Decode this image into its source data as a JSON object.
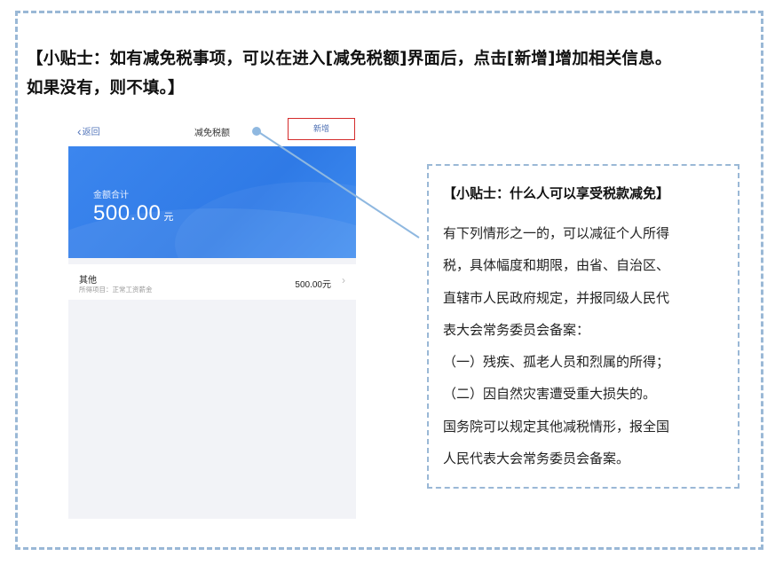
{
  "heading": {
    "line1": "【小贴士：如有减免税事项，可以在进入[减免税额]界面后，点击[新增]增加相关信息。",
    "line2": "如果没有，则不填。】"
  },
  "phone": {
    "nav": {
      "back_label": "返回",
      "back_icon": "chevron-left",
      "title": "减免税额",
      "add_label": "新增"
    },
    "hero": {
      "label": "金额合计",
      "amount": "500.00",
      "unit": "元"
    },
    "item": {
      "title": "其他",
      "subtitle": "所得项目：正常工资薪金",
      "value": "500.00元",
      "chevron_icon": "chevron-right"
    }
  },
  "tip_box": {
    "title": "【小贴士：什么人可以享受税款减免】",
    "lines": [
      "有下列情形之一的，可以减征个人所得",
      "税，具体幅度和期限，由省、自治区、",
      "直辖市人民政府规定，并报同级人民代",
      "表大会常务委员会备案：",
      "（一）残疾、孤老人员和烈属的所得；",
      "（二）因自然灾害遭受重大损失的。",
      "国务院可以规定其他减税情形，报全国",
      "人民代表大会常务委员会备案。"
    ]
  },
  "colors": {
    "frame_border": "#9ab8d6",
    "hero_blue": "#3c86ee",
    "highlight_red": "#d42b2b",
    "connector": "#8fb8e0"
  }
}
